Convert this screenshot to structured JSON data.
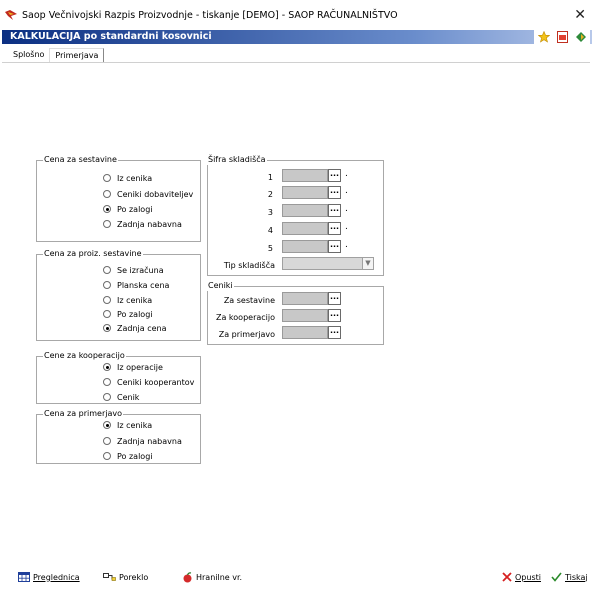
{
  "window": {
    "title": "Saop  Večnivojski Razpis Proizvodnje  - tiskanje [DEMO] - SAOP RAČUNALNIŠTVO",
    "close": "✕"
  },
  "header": {
    "title": "KALKULACIJA po standardni kosovnici"
  },
  "tabs": [
    {
      "label": "Splošno"
    },
    {
      "label": "Primerjava"
    }
  ],
  "groups": {
    "cena_za_sestavine": {
      "title": "Cena za sestavine",
      "options": [
        {
          "label": "Iz cenika",
          "selected": false
        },
        {
          "label": "Ceniki dobaviteljev",
          "selected": false
        },
        {
          "label": "Po zalogi",
          "selected": true
        },
        {
          "label": "Zadnja nabavna",
          "selected": false
        }
      ]
    },
    "cena_za_proiz_sestavine": {
      "title": "Cena za proiz. sestavine",
      "options": [
        {
          "label": "Se izračuna",
          "selected": false
        },
        {
          "label": "Planska cena",
          "selected": false
        },
        {
          "label": "Iz cenika",
          "selected": false
        },
        {
          "label": "Po zalogi",
          "selected": false
        },
        {
          "label": "Zadnja cena",
          "selected": true
        }
      ]
    },
    "cene_za_kooperacijo": {
      "title": "Cene za kooperacijo",
      "options": [
        {
          "label": "Iz operacije",
          "selected": true
        },
        {
          "label": "Ceniki kooperantov",
          "selected": false
        },
        {
          "label": "Cenik",
          "selected": false
        }
      ]
    },
    "cena_za_primerjavo": {
      "title": "Cena za primerjavo",
      "options": [
        {
          "label": "Iz cenika",
          "selected": true
        },
        {
          "label": "Zadnja nabavna",
          "selected": false
        },
        {
          "label": "Po zalogi",
          "selected": false
        }
      ]
    }
  },
  "sifra_skladisca": {
    "title": "Šifra skladišča",
    "rows": [
      {
        "label": "1",
        "value": ""
      },
      {
        "label": "2",
        "value": ""
      },
      {
        "label": "3",
        "value": ""
      },
      {
        "label": "4",
        "value": ""
      },
      {
        "label": "5",
        "value": ""
      }
    ],
    "tip_label": "Tip skladišča",
    "tip_value": "",
    "dot": ".",
    "lookup": "..."
  },
  "ceniki": {
    "title": "Ceniki",
    "rows": [
      {
        "label": "Za sestavine",
        "value": ""
      },
      {
        "label": "Za kooperacijo",
        "value": ""
      },
      {
        "label": "Za primerjavo",
        "value": ""
      }
    ]
  },
  "bottom": {
    "preglednica": "Preglednica",
    "poreklo": "Poreklo",
    "hranilne": "Hranilne vr.",
    "opusti": "Opusti",
    "tiskaj": "Tiskaj"
  },
  "colors": {
    "header_start": "#0b2f82",
    "header_end": "#b8c9ea",
    "cancel_red": "#d62020",
    "ok_green": "#2a8a2a"
  }
}
